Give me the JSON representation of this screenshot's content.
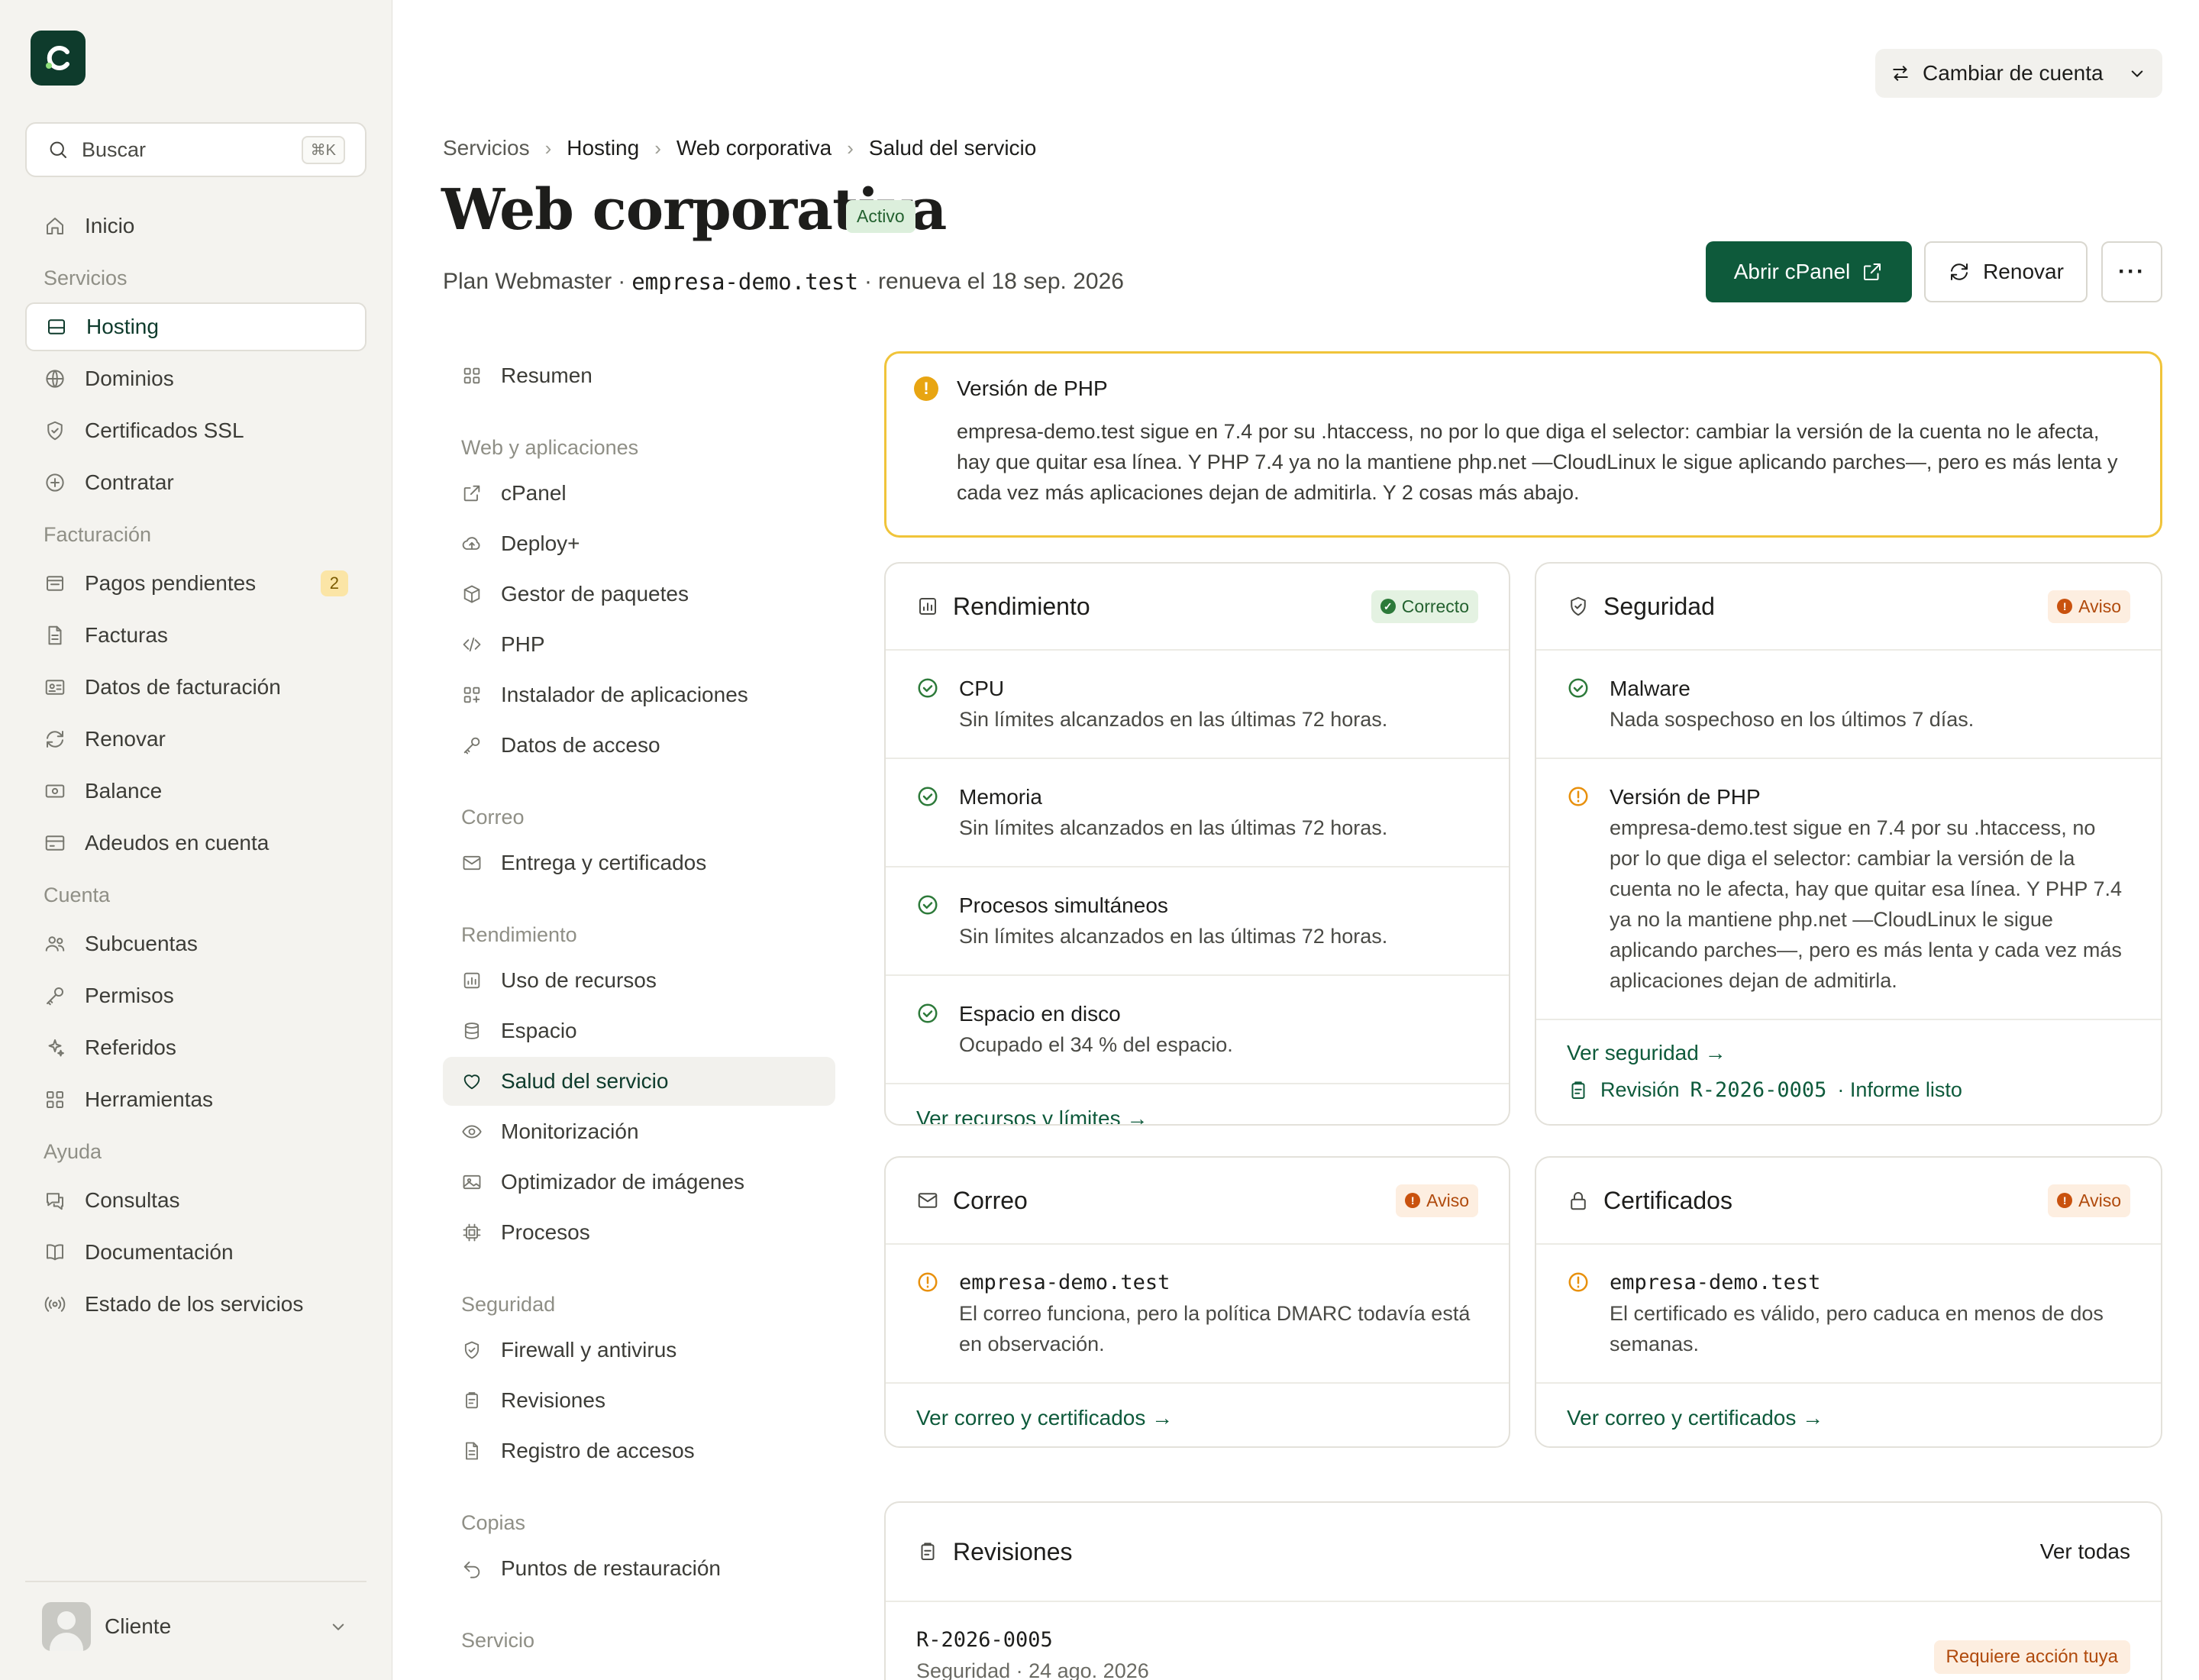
{
  "sidebar": {
    "search_label": "Buscar",
    "search_shortcut": "⌘K",
    "nav": [
      {
        "type": "item",
        "label": "Inicio",
        "icon": "home-icon"
      },
      {
        "type": "section",
        "label": "Servicios"
      },
      {
        "type": "item",
        "label": "Hosting",
        "icon": "server-icon",
        "active": true
      },
      {
        "type": "item",
        "label": "Dominios",
        "icon": "globe-icon"
      },
      {
        "type": "item",
        "label": "Certificados SSL",
        "icon": "shield-icon"
      },
      {
        "type": "item",
        "label": "Contratar",
        "icon": "plus-circle-icon"
      },
      {
        "type": "section",
        "label": "Facturación"
      },
      {
        "type": "item",
        "label": "Pagos pendientes",
        "icon": "receipt-icon",
        "badge": "2"
      },
      {
        "type": "item",
        "label": "Facturas",
        "icon": "file-icon"
      },
      {
        "type": "item",
        "label": "Datos de facturación",
        "icon": "id-card-icon"
      },
      {
        "type": "item",
        "label": "Renovar",
        "icon": "refresh-icon"
      },
      {
        "type": "item",
        "label": "Balance",
        "icon": "cash-icon"
      },
      {
        "type": "item",
        "label": "Adeudos en cuenta",
        "icon": "credit-card-icon"
      },
      {
        "type": "section",
        "label": "Cuenta"
      },
      {
        "type": "item",
        "label": "Subcuentas",
        "icon": "users-icon"
      },
      {
        "type": "item",
        "label": "Permisos",
        "icon": "key-icon"
      },
      {
        "type": "item",
        "label": "Referidos",
        "icon": "sparkles-icon"
      },
      {
        "type": "item",
        "label": "Herramientas",
        "icon": "grid-icon"
      },
      {
        "type": "section",
        "label": "Ayuda"
      },
      {
        "type": "item",
        "label": "Consultas",
        "icon": "chat-icon"
      },
      {
        "type": "item",
        "label": "Documentación",
        "icon": "book-icon"
      },
      {
        "type": "item",
        "label": "Estado de los servicios",
        "icon": "broadcast-icon"
      }
    ],
    "user_name": "Cliente"
  },
  "header": {
    "switch_account": "Cambiar de cuenta",
    "breadcrumb": [
      "Servicios",
      "Hosting",
      "Web corporativa",
      "Salud del servicio"
    ],
    "title": "Web corporativa",
    "status": "Activo",
    "plan": "Plan Webmaster",
    "domain": "empresa-demo.test",
    "renewal": "renueva el 18 sep. 2026",
    "sep": "·",
    "open_cpanel": "Abrir cPanel",
    "renew": "Renovar",
    "more": "···"
  },
  "subnav": [
    {
      "type": "item",
      "label": "Resumen",
      "icon": "grid-icon"
    },
    {
      "type": "section",
      "label": "Web y aplicaciones"
    },
    {
      "type": "item",
      "label": "cPanel",
      "icon": "external-link-icon"
    },
    {
      "type": "item",
      "label": "Deploy+",
      "icon": "cloud-upload-icon"
    },
    {
      "type": "item",
      "label": "Gestor de paquetes",
      "icon": "package-icon"
    },
    {
      "type": "item",
      "label": "PHP",
      "icon": "code-icon"
    },
    {
      "type": "item",
      "label": "Instalador de aplicaciones",
      "icon": "apps-icon"
    },
    {
      "type": "item",
      "label": "Datos de acceso",
      "icon": "key-icon"
    },
    {
      "type": "section",
      "label": "Correo"
    },
    {
      "type": "item",
      "label": "Entrega y certificados",
      "icon": "mail-icon"
    },
    {
      "type": "section",
      "label": "Rendimiento"
    },
    {
      "type": "item",
      "label": "Uso de recursos",
      "icon": "bar-chart-icon"
    },
    {
      "type": "item",
      "label": "Espacio",
      "icon": "database-icon"
    },
    {
      "type": "item",
      "label": "Salud del servicio",
      "icon": "heart-icon",
      "active": true
    },
    {
      "type": "item",
      "label": "Monitorización",
      "icon": "eye-icon"
    },
    {
      "type": "item",
      "label": "Optimizador de imágenes",
      "icon": "image-icon"
    },
    {
      "type": "item",
      "label": "Procesos",
      "icon": "cpu-icon"
    },
    {
      "type": "section",
      "label": "Seguridad"
    },
    {
      "type": "item",
      "label": "Firewall y antivirus",
      "icon": "shield-icon"
    },
    {
      "type": "item",
      "label": "Revisiones",
      "icon": "clipboard-icon"
    },
    {
      "type": "item",
      "label": "Registro de accesos",
      "icon": "file-icon"
    },
    {
      "type": "section",
      "label": "Copias"
    },
    {
      "type": "item",
      "label": "Puntos de restauración",
      "icon": "undo-icon"
    },
    {
      "type": "section",
      "label": "Servicio"
    }
  ],
  "alert": {
    "title": "Versión de PHP",
    "body": "empresa-demo.test sigue en 7.4 por su .htaccess, no por lo que diga el selector: cambiar la versión de la cuenta no le afecta, hay que quitar esa línea. Y PHP 7.4 ya no la mantiene php.net —CloudLinux le sigue aplicando parches—, pero es más lenta y cada vez más aplicaciones dejan de admitirla. Y 2 cosas más abajo."
  },
  "performance": {
    "title": "Rendimiento",
    "status": "Correcto",
    "rows": [
      {
        "title": "CPU",
        "desc": "Sin límites alcanzados en las últimas 72 horas."
      },
      {
        "title": "Memoria",
        "desc": "Sin límites alcanzados en las últimas 72 horas."
      },
      {
        "title": "Procesos simultáneos",
        "desc": "Sin límites alcanzados en las últimas 72 horas."
      },
      {
        "title": "Espacio en disco",
        "desc": "Ocupado el 34 % del espacio."
      }
    ],
    "link": "Ver recursos y límites →"
  },
  "security": {
    "title": "Seguridad",
    "status": "Aviso",
    "rows": [
      {
        "title": "Malware",
        "desc": "Nada sospechoso en los últimos 7 días."
      },
      {
        "title": "Versión de PHP",
        "desc": "empresa-demo.test sigue en 7.4 por su .htaccess, no por lo que diga el selector: cambiar la versión de la cuenta no le afecta, hay que quitar esa línea. Y PHP 7.4 ya no la mantiene php.net —CloudLinux le sigue aplicando parches—, pero es más lenta y cada vez más aplicaciones dejan de admitirla."
      }
    ],
    "link": "Ver seguridad →",
    "review_prefix": "Revisión",
    "review_id": "R-2026-0005",
    "review_suffix": "· Informe listo"
  },
  "mail": {
    "title": "Correo",
    "status": "Aviso",
    "domain": "empresa-demo.test",
    "desc": "El correo funciona, pero la política DMARC todavía está en observación.",
    "link": "Ver correo y certificados →"
  },
  "certs": {
    "title": "Certificados",
    "status": "Aviso",
    "domain": "empresa-demo.test",
    "desc": "El certificado es válido, pero caduca en menos de dos semanas.",
    "link": "Ver correo y certificados →"
  },
  "reviews": {
    "title": "Revisiones",
    "view_all": "Ver todas",
    "item_id": "R-2026-0005",
    "item_meta": "Seguridad · 24 ago. 2026",
    "item_status": "Requiere acción tuya"
  }
}
